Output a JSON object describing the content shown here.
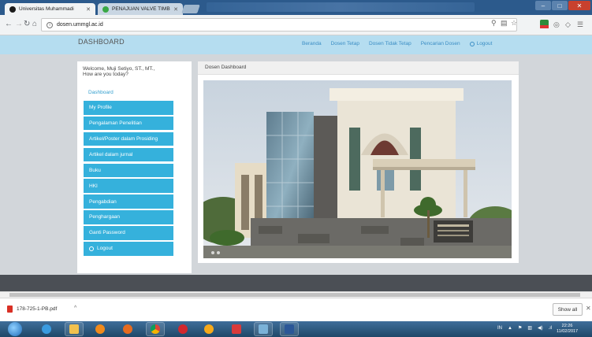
{
  "browser": {
    "tabs": [
      {
        "label": "Universitas Muhammadi",
        "active": true
      },
      {
        "label": "PENAJUAN VALVE TIMB",
        "active": false
      }
    ],
    "url": "dosen.ummgl.ac.id"
  },
  "site": {
    "brand": "DASHBOARD",
    "nav": [
      "Beranda",
      "Dosen Tetap",
      "Dosen Tidak Tetap",
      "Pencarian Dosen"
    ],
    "logout": "Logout"
  },
  "sidebar": {
    "welcome_line1": "Welcome, Muji Setiyo, ST., MT.,",
    "welcome_line2": "How are you today?",
    "active_item": "Dashboard",
    "items": [
      "My Profile",
      "Pengalaman Penelitian",
      "Artikel/Poster dalam Prosiding",
      "Artikel dalam jurnal",
      "Buku",
      "HKI",
      "Pengabdian",
      "Penghargaan",
      "Ganti Password",
      "Logout"
    ]
  },
  "main": {
    "panel_title": "Dosen Dashboard",
    "building_sign": "GEDUNG ..."
  },
  "downloads": {
    "file": "178-725-1-PB.pdf",
    "show_all": "Show all"
  },
  "taskbar": {
    "lang": "IN",
    "time": "22:26",
    "date": "11/02/2017"
  },
  "colors": {
    "accent": "#35b1dc",
    "topnav": "#b5ddf0",
    "link": "#3a8dc4"
  }
}
